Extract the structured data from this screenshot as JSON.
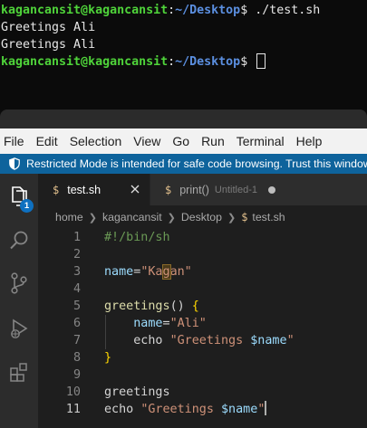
{
  "terminal": {
    "lines": [
      {
        "user": "kagancansit@kagancansit",
        "colon": ":",
        "path": "~/Desktop",
        "prompt": "$ ",
        "cmd": "./test.sh"
      },
      {
        "text": "Greetings Ali"
      },
      {
        "text": "Greetings Ali"
      },
      {
        "user": "kagancansit@kagancansit",
        "colon": ":",
        "path": "~/Desktop",
        "prompt": "$ ",
        "cmd": ""
      }
    ]
  },
  "menubar": [
    "File",
    "Edit",
    "Selection",
    "View",
    "Go",
    "Run",
    "Terminal",
    "Help"
  ],
  "banner": {
    "text": "Restricted Mode is intended for safe code browsing. Trust this window"
  },
  "activity": {
    "badge": "1"
  },
  "tabs": [
    {
      "icon": "$",
      "label": "test.sh",
      "active": true
    },
    {
      "icon": "$",
      "label": "print()",
      "description": "Untitled-1",
      "dirty": true
    }
  ],
  "breadcrumb": [
    "home",
    "kagancansit",
    "Desktop",
    "test.sh"
  ],
  "breadcrumb_file_icon": "$",
  "editor": {
    "active_line": 11,
    "lines": [
      {
        "n": "1",
        "parts": [
          {
            "t": "#!/bin/sh",
            "c": "comment"
          }
        ]
      },
      {
        "n": "2",
        "parts": []
      },
      {
        "n": "3",
        "parts": [
          {
            "t": "name",
            "c": "var"
          },
          {
            "t": "=",
            "c": "op"
          },
          {
            "t": "\"Ka",
            "c": "str"
          },
          {
            "t": "g",
            "c": "str-hl"
          },
          {
            "t": "an\"",
            "c": "str"
          }
        ]
      },
      {
        "n": "4",
        "parts": []
      },
      {
        "n": "5",
        "parts": [
          {
            "t": "greetings",
            "c": "fn"
          },
          {
            "t": "() ",
            "c": "text"
          },
          {
            "t": "{",
            "c": "brace"
          }
        ]
      },
      {
        "n": "6",
        "parts": [
          {
            "t": "    name",
            "c": "var"
          },
          {
            "t": "=",
            "c": "op"
          },
          {
            "t": "\"Ali\"",
            "c": "str"
          }
        ]
      },
      {
        "n": "7",
        "parts": [
          {
            "t": "    echo ",
            "c": "text"
          },
          {
            "t": "\"Greetings ",
            "c": "str"
          },
          {
            "t": "$name",
            "c": "var"
          },
          {
            "t": "\"",
            "c": "str"
          }
        ]
      },
      {
        "n": "8",
        "parts": [
          {
            "t": "}",
            "c": "brace"
          }
        ]
      },
      {
        "n": "9",
        "parts": []
      },
      {
        "n": "10",
        "parts": [
          {
            "t": "greetings",
            "c": "text"
          }
        ]
      },
      {
        "n": "11",
        "parts": [
          {
            "t": "echo ",
            "c": "text"
          },
          {
            "t": "\"Greetings ",
            "c": "str"
          },
          {
            "t": "$name",
            "c": "var"
          },
          {
            "t": "\"",
            "c": "str"
          },
          {
            "t": "",
            "c": "caret"
          }
        ]
      }
    ]
  },
  "colors": {
    "terminal_user": "#4fd43a",
    "terminal_path": "#5b8fe0",
    "banner_bg": "#0e639c",
    "editor_bg": "#1e1e1e",
    "string": "#ce9178",
    "variable": "#9cdcfe",
    "comment": "#6a9955",
    "function": "#dcdcaa",
    "brace": "#ffd700"
  },
  "icons": [
    "shield-icon",
    "explorer-icon",
    "search-icon",
    "source-control-icon",
    "run-debug-icon",
    "extensions-icon",
    "close-icon"
  ]
}
